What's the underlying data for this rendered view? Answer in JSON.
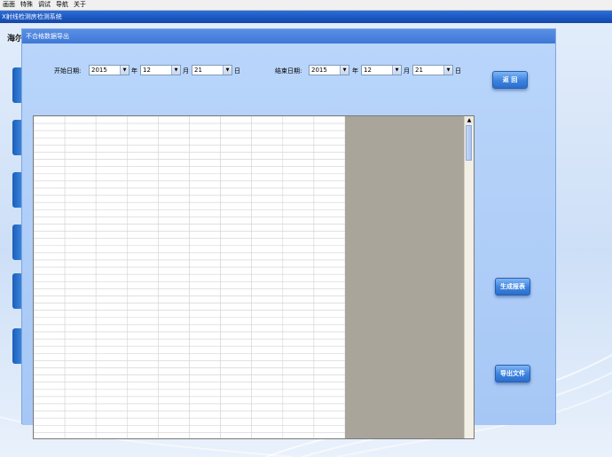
{
  "menu": {
    "items": [
      "画面",
      "特殊",
      "调试",
      "导航",
      "关于"
    ]
  },
  "app_title": "X射线检测房检测系统",
  "bg_label": "海尔",
  "dialog": {
    "title": "不合格数据导出",
    "start_label": "开始日期:",
    "end_label": "结束日期:",
    "year_unit": "年",
    "month_unit": "月",
    "day_unit": "日",
    "start": {
      "year": "2015",
      "month": "12",
      "day": "21"
    },
    "end": {
      "year": "2015",
      "month": "12",
      "day": "21"
    },
    "buttons": {
      "back": "返  回",
      "report": "生成报表",
      "export": "导出文件"
    }
  },
  "grid": {
    "columns": 10,
    "rows": 45
  },
  "colors": {
    "title_bar": "#1a55c0",
    "dialog_bg": "#a7c8f5",
    "grid_bg": "#aaa59b",
    "button": "#3b82df"
  }
}
